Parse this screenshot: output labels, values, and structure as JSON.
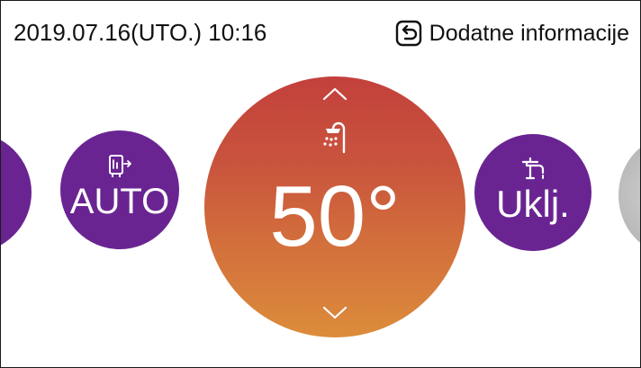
{
  "header": {
    "datetime": "2019.07.16(UTO.)  10:16",
    "info_label": "Dodatne informacije",
    "info_icon": "back-return-icon"
  },
  "modes": {
    "auto": {
      "label": "AUTO",
      "icon": "water-tank-icon",
      "color": "#6a2492"
    },
    "hot_water": {
      "temperature": "50°",
      "icon": "shower-icon",
      "up_icon": "chevron-up-icon",
      "down_icon": "chevron-down-icon"
    },
    "power": {
      "label": "Uklj.",
      "icon": "faucet-icon",
      "color": "#6a2492"
    }
  },
  "colors": {
    "accent_purple": "#6a2492",
    "gradient_top": "#c3403c",
    "gradient_bottom": "#dc8c3b",
    "neighbor_gray": "#a8a8a8"
  }
}
